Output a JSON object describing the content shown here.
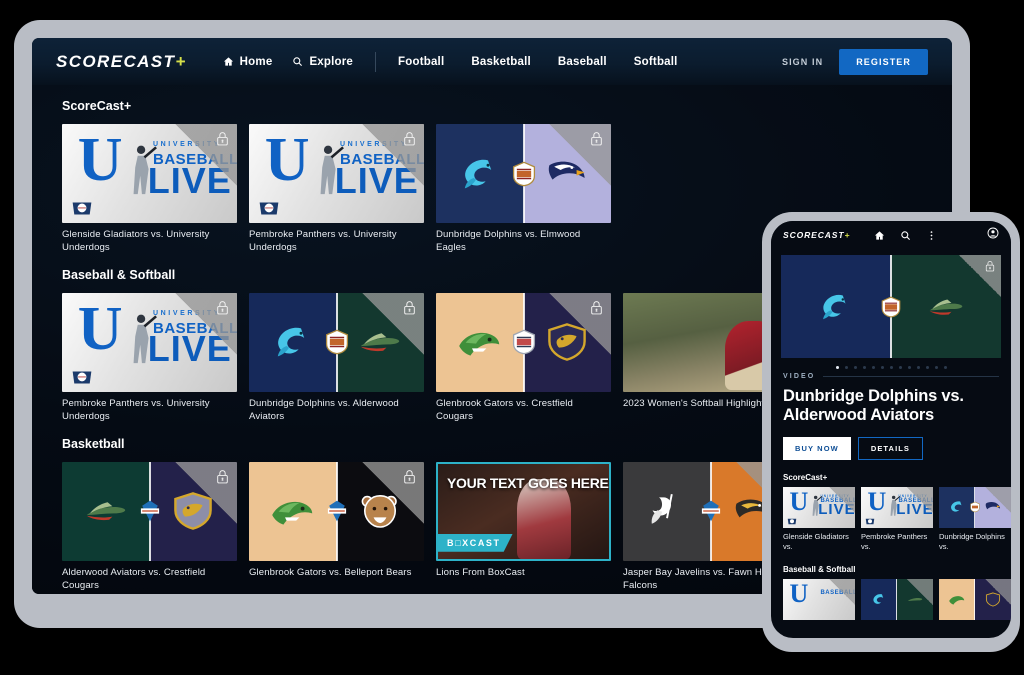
{
  "brand": {
    "name": "SCORECAST",
    "plus": "+"
  },
  "colors": {
    "accent_blue": "#1268c3",
    "plus_yellow": "#d6e04a",
    "boxcast_cyan": "#2db2c8",
    "frame_gray": "#b9bdc5"
  },
  "nav": {
    "links": [
      {
        "label": "Home",
        "icon": "home-icon"
      },
      {
        "label": "Explore",
        "icon": "search-icon"
      }
    ],
    "categories": [
      "Football",
      "Basketball",
      "Baseball",
      "Softball"
    ],
    "sign_in": "SIGN IN",
    "register": "REGISTER"
  },
  "sections": [
    {
      "title": "ScoreCast+",
      "cards": [
        {
          "caption": "Glenside Gladiators vs. University Underdogs",
          "art": "baseball-poster",
          "locked": true
        },
        {
          "caption": "Pembroke Panthers vs. University Underdogs",
          "art": "baseball-poster",
          "locked": true
        },
        {
          "caption": "Dunbridge Dolphins vs. Elmwood Eagles",
          "art": "dolphins-eagles",
          "locked": true
        }
      ]
    },
    {
      "title": "Baseball & Softball",
      "cards": [
        {
          "caption": "Pembroke Panthers vs. University Underdogs",
          "art": "baseball-poster",
          "locked": true
        },
        {
          "caption": "Dunbridge Dolphins vs. Alderwood Aviators",
          "art": "dolphins-aviators",
          "locked": true
        },
        {
          "caption": "Glenbrook Gators vs. Crestfield Cougars",
          "art": "gators-cougars",
          "locked": true
        },
        {
          "caption": "2023 Women's Softball Highlights",
          "art": "softball-photo",
          "locked": false
        }
      ]
    },
    {
      "title": "Basketball",
      "cards": [
        {
          "caption": "Alderwood Aviators vs. Crestfield Cougars",
          "art": "aviators-cougars",
          "locked": true
        },
        {
          "caption": "Glenbrook Gators vs. Belleport Bears",
          "art": "gators-bears",
          "locked": true
        },
        {
          "caption": "Lions From BoxCast",
          "art": "boxcast-promo",
          "locked": false,
          "overlay_text": "YOUR TEXT GOES HERE",
          "tag": "B□XCAST"
        },
        {
          "caption": "Jasper Bay Javelins vs. Fawn Hill Falcons",
          "art": "javelins-falcons",
          "locked": true
        }
      ]
    }
  ],
  "poster": {
    "line1": "UNIVERSITY",
    "line2": "BASEBALL",
    "line3": "LIVE",
    "letter": "U"
  },
  "phone": {
    "icons": [
      "home-icon",
      "search-icon",
      "kebab-menu-icon",
      "account-icon"
    ],
    "carousel_dots": 13,
    "active_dot": 0,
    "kicker": "VIDEO",
    "title": "Dunbridge Dolphins vs. Alderwood Aviators",
    "buy_label": "BUY NOW",
    "details_label": "DETAILS",
    "sections": [
      {
        "title": "ScoreCast+",
        "cards": [
          {
            "caption": "Glenside Gladiators vs.",
            "art": "baseball-poster"
          },
          {
            "caption": "Pembroke Panthers vs.",
            "art": "baseball-poster"
          },
          {
            "caption": "Dunbridge Dolphins vs.",
            "art": "dolphins-eagles"
          }
        ]
      },
      {
        "title": "Baseball & Softball",
        "cards": [
          {
            "caption": "",
            "art": "baseball-poster"
          },
          {
            "caption": "",
            "art": "dolphins-aviators"
          },
          {
            "caption": "",
            "art": "gators-cougars"
          }
        ]
      }
    ]
  }
}
